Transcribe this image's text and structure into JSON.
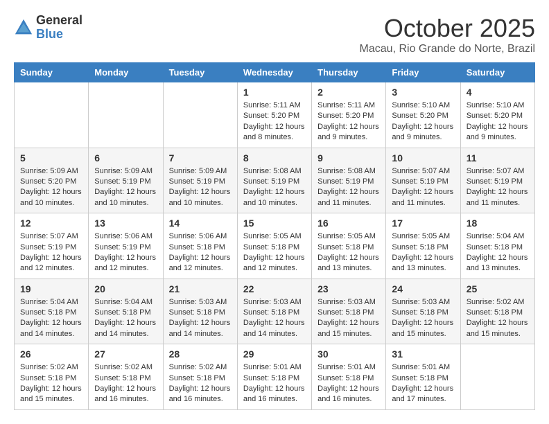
{
  "header": {
    "logo_general": "General",
    "logo_blue": "Blue",
    "month": "October 2025",
    "location": "Macau, Rio Grande do Norte, Brazil"
  },
  "days_of_week": [
    "Sunday",
    "Monday",
    "Tuesday",
    "Wednesday",
    "Thursday",
    "Friday",
    "Saturday"
  ],
  "weeks": [
    [
      {
        "day": "",
        "info": ""
      },
      {
        "day": "",
        "info": ""
      },
      {
        "day": "",
        "info": ""
      },
      {
        "day": "1",
        "info": "Sunrise: 5:11 AM\nSunset: 5:20 PM\nDaylight: 12 hours and 8 minutes."
      },
      {
        "day": "2",
        "info": "Sunrise: 5:11 AM\nSunset: 5:20 PM\nDaylight: 12 hours and 9 minutes."
      },
      {
        "day": "3",
        "info": "Sunrise: 5:10 AM\nSunset: 5:20 PM\nDaylight: 12 hours and 9 minutes."
      },
      {
        "day": "4",
        "info": "Sunrise: 5:10 AM\nSunset: 5:20 PM\nDaylight: 12 hours and 9 minutes."
      }
    ],
    [
      {
        "day": "5",
        "info": "Sunrise: 5:09 AM\nSunset: 5:20 PM\nDaylight: 12 hours and 10 minutes."
      },
      {
        "day": "6",
        "info": "Sunrise: 5:09 AM\nSunset: 5:19 PM\nDaylight: 12 hours and 10 minutes."
      },
      {
        "day": "7",
        "info": "Sunrise: 5:09 AM\nSunset: 5:19 PM\nDaylight: 12 hours and 10 minutes."
      },
      {
        "day": "8",
        "info": "Sunrise: 5:08 AM\nSunset: 5:19 PM\nDaylight: 12 hours and 10 minutes."
      },
      {
        "day": "9",
        "info": "Sunrise: 5:08 AM\nSunset: 5:19 PM\nDaylight: 12 hours and 11 minutes."
      },
      {
        "day": "10",
        "info": "Sunrise: 5:07 AM\nSunset: 5:19 PM\nDaylight: 12 hours and 11 minutes."
      },
      {
        "day": "11",
        "info": "Sunrise: 5:07 AM\nSunset: 5:19 PM\nDaylight: 12 hours and 11 minutes."
      }
    ],
    [
      {
        "day": "12",
        "info": "Sunrise: 5:07 AM\nSunset: 5:19 PM\nDaylight: 12 hours and 12 minutes."
      },
      {
        "day": "13",
        "info": "Sunrise: 5:06 AM\nSunset: 5:19 PM\nDaylight: 12 hours and 12 minutes."
      },
      {
        "day": "14",
        "info": "Sunrise: 5:06 AM\nSunset: 5:18 PM\nDaylight: 12 hours and 12 minutes."
      },
      {
        "day": "15",
        "info": "Sunrise: 5:05 AM\nSunset: 5:18 PM\nDaylight: 12 hours and 12 minutes."
      },
      {
        "day": "16",
        "info": "Sunrise: 5:05 AM\nSunset: 5:18 PM\nDaylight: 12 hours and 13 minutes."
      },
      {
        "day": "17",
        "info": "Sunrise: 5:05 AM\nSunset: 5:18 PM\nDaylight: 12 hours and 13 minutes."
      },
      {
        "day": "18",
        "info": "Sunrise: 5:04 AM\nSunset: 5:18 PM\nDaylight: 12 hours and 13 minutes."
      }
    ],
    [
      {
        "day": "19",
        "info": "Sunrise: 5:04 AM\nSunset: 5:18 PM\nDaylight: 12 hours and 14 minutes."
      },
      {
        "day": "20",
        "info": "Sunrise: 5:04 AM\nSunset: 5:18 PM\nDaylight: 12 hours and 14 minutes."
      },
      {
        "day": "21",
        "info": "Sunrise: 5:03 AM\nSunset: 5:18 PM\nDaylight: 12 hours and 14 minutes."
      },
      {
        "day": "22",
        "info": "Sunrise: 5:03 AM\nSunset: 5:18 PM\nDaylight: 12 hours and 14 minutes."
      },
      {
        "day": "23",
        "info": "Sunrise: 5:03 AM\nSunset: 5:18 PM\nDaylight: 12 hours and 15 minutes."
      },
      {
        "day": "24",
        "info": "Sunrise: 5:03 AM\nSunset: 5:18 PM\nDaylight: 12 hours and 15 minutes."
      },
      {
        "day": "25",
        "info": "Sunrise: 5:02 AM\nSunset: 5:18 PM\nDaylight: 12 hours and 15 minutes."
      }
    ],
    [
      {
        "day": "26",
        "info": "Sunrise: 5:02 AM\nSunset: 5:18 PM\nDaylight: 12 hours and 15 minutes."
      },
      {
        "day": "27",
        "info": "Sunrise: 5:02 AM\nSunset: 5:18 PM\nDaylight: 12 hours and 16 minutes."
      },
      {
        "day": "28",
        "info": "Sunrise: 5:02 AM\nSunset: 5:18 PM\nDaylight: 12 hours and 16 minutes."
      },
      {
        "day": "29",
        "info": "Sunrise: 5:01 AM\nSunset: 5:18 PM\nDaylight: 12 hours and 16 minutes."
      },
      {
        "day": "30",
        "info": "Sunrise: 5:01 AM\nSunset: 5:18 PM\nDaylight: 12 hours and 16 minutes."
      },
      {
        "day": "31",
        "info": "Sunrise: 5:01 AM\nSunset: 5:18 PM\nDaylight: 12 hours and 17 minutes."
      },
      {
        "day": "",
        "info": ""
      }
    ]
  ]
}
